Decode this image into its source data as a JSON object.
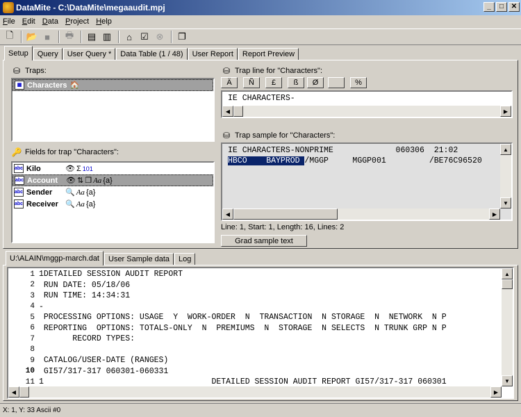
{
  "window": {
    "title": "DataMite - C:\\DataMite\\megaaudit.mpj",
    "minimize": "_",
    "maximize": "□",
    "close": "✕"
  },
  "menu": [
    {
      "label": "File",
      "accel": "F",
      "rest": "ile"
    },
    {
      "label": "Edit",
      "accel": "E",
      "rest": "dit"
    },
    {
      "label": "Data",
      "accel": "D",
      "rest": "ata"
    },
    {
      "label": "Project",
      "accel": "P",
      "rest": "roject"
    },
    {
      "label": "Help",
      "accel": "H",
      "rest": "elp"
    }
  ],
  "toolbar_icons": [
    "new-file-icon",
    "open-folder-icon",
    "save-icon",
    "print-icon",
    "import-icon",
    "export-icon",
    "run-query-icon",
    "validate-icon",
    "cancel-icon",
    "copy-icon"
  ],
  "main_tabs": [
    "Setup",
    "Query",
    "User Query *",
    "Data Table (1 / 48)",
    "User Report",
    "Report Preview"
  ],
  "traps": {
    "label": "Traps:",
    "items": [
      {
        "name": "Characters"
      }
    ]
  },
  "fields": {
    "label": "Fields for trap \"Characters\":",
    "items": [
      {
        "name": "Kilo",
        "extra": "101"
      },
      {
        "name": "Account",
        "extra": "Aa",
        "extra2": "{a}"
      },
      {
        "name": "Sender",
        "extra": "Aa",
        "extra2": "{a}"
      },
      {
        "name": "Receiver",
        "extra": "Aa",
        "extra2": "{a}"
      }
    ]
  },
  "trap_line": {
    "label": "Trap line for \"Characters\":",
    "char_buttons": [
      "Ä",
      "Ñ",
      "£",
      "ß",
      "Ø",
      "",
      "%"
    ],
    "text": "IE CHARACTERS-"
  },
  "trap_sample": {
    "label": "Trap sample for \"Characters\":",
    "line1": "IE CHARACTERS-NONPRIME             060306  21:02",
    "line2_hl": "HBCO    BAYPROD ",
    "line2_rest": "/MGGP     MGGP001         /BE76C96520"
  },
  "sample_status": "Line: 1, Start: 1, Length: 16, Lines: 2",
  "grab_button": "Grad sample text",
  "bottom_tabs": [
    "U:\\ALAIN\\mggp-march.dat",
    "User Sample data",
    "Log"
  ],
  "editor_lines": [
    {
      "n": "1",
      "text": "1DETAILED SESSION AUDIT REPORT"
    },
    {
      "n": "2",
      "text": " RUN DATE: 05/18/06"
    },
    {
      "n": "3",
      "text": " RUN TIME: 14:34:31"
    },
    {
      "n": "4",
      "text": "-"
    },
    {
      "n": "5",
      "text": " PROCESSING OPTIONS: USAGE  Y  WORK-ORDER  N  TRANSACTION  N STORAGE  N  NETWORK  N P"
    },
    {
      "n": "6",
      "text": " REPORTING  OPTIONS: TOTALS-ONLY  N  PREMIUMS  N  STORAGE  N SELECTS  N TRUNK GRP N P"
    },
    {
      "n": "7",
      "text": "       RECORD TYPES:"
    },
    {
      "n": "8",
      "text": ""
    },
    {
      "n": "9",
      "text": " CATALOG/USER-DATE (RANGES)"
    },
    {
      "n": "10",
      "text": " GI57/317-317 060301-060331"
    },
    {
      "n": "11",
      "text": "1                                   DETAILED SESSION AUDIT REPORT GI57/317-317 060301"
    }
  ],
  "current_line": "10",
  "status": "X: 1, Y: 33  Ascii #0"
}
